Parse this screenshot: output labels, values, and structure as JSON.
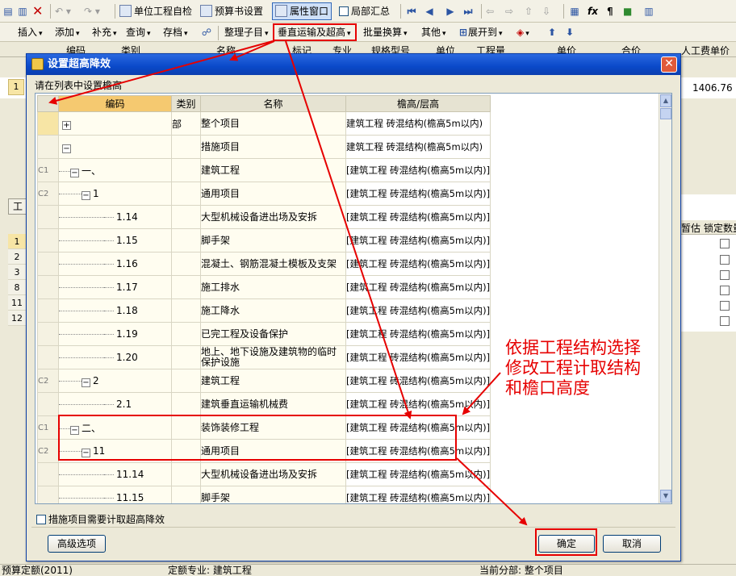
{
  "toolbar1": {
    "unit_check": "单位工程自检",
    "budget_settings": "预算书设置",
    "attr_window": "属性窗口",
    "partial_summary": "局部汇总"
  },
  "toolbar2": {
    "insert": "插入",
    "add": "添加",
    "supplement": "补充",
    "query": "查询",
    "archive": "存档",
    "organize": "整理子目",
    "vertical_transport": "垂直运输及超高",
    "batch_convert": "批量换算",
    "other": "其他",
    "expand_to": "展开到"
  },
  "background": {
    "grid_header_labels": [
      "编码",
      "类别",
      "名称",
      "标记",
      "专业",
      "规格型号",
      "单位",
      "工程量",
      "单价",
      "合价",
      "人工费单价"
    ],
    "row1_number": "1",
    "row1_value": "1406.76",
    "bottom_panel_tab": "工",
    "right_headers": [
      "暂估",
      "锁定数量"
    ],
    "row_numbers": [
      "1",
      "2",
      "3",
      "8",
      "11",
      "12"
    ]
  },
  "dialog": {
    "title": "设置超高降效",
    "hint": "请在列表中设置檐高",
    "columns": {
      "code": "编码",
      "type": "类别",
      "name": "名称",
      "height": "檐高/层高"
    },
    "rows": [
      {
        "rh": "",
        "code": "",
        "type": "部",
        "name": "整个项目",
        "value": "建筑工程 砖混结构(檐高5m以内)"
      },
      {
        "rh": "",
        "code": "",
        "type": "",
        "name": "措施项目",
        "value": "建筑工程 砖混结构(檐高5m以内)"
      },
      {
        "rh": "C1",
        "code": "一、",
        "type": "",
        "name": "建筑工程",
        "value": "[建筑工程 砖混结构(檐高5m以内)]"
      },
      {
        "rh": "C2",
        "code": "1",
        "type": "",
        "name": "通用项目",
        "value": "[建筑工程 砖混结构(檐高5m以内)]"
      },
      {
        "rh": "",
        "code": "1.14",
        "type": "",
        "name": "大型机械设备进出场及安拆",
        "value": "[建筑工程 砖混结构(檐高5m以内)]"
      },
      {
        "rh": "",
        "code": "1.15",
        "type": "",
        "name": "脚手架",
        "value": "[建筑工程 砖混结构(檐高5m以内)]"
      },
      {
        "rh": "",
        "code": "1.16",
        "type": "",
        "name": "混凝土、钢筋混凝土模板及支架",
        "value": "[建筑工程 砖混结构(檐高5m以内)]"
      },
      {
        "rh": "",
        "code": "1.17",
        "type": "",
        "name": "施工排水",
        "value": "[建筑工程 砖混结构(檐高5m以内)]"
      },
      {
        "rh": "",
        "code": "1.18",
        "type": "",
        "name": "施工降水",
        "value": "[建筑工程 砖混结构(檐高5m以内)]"
      },
      {
        "rh": "",
        "code": "1.19",
        "type": "",
        "name": "已完工程及设备保护",
        "value": "[建筑工程 砖混结构(檐高5m以内)]"
      },
      {
        "rh": "",
        "code": "1.20",
        "type": "",
        "name": "地上、地下设施及建筑物的临时保护设施",
        "value": "[建筑工程 砖混结构(檐高5m以内)]"
      },
      {
        "rh": "C2",
        "code": "2",
        "type": "",
        "name": "建筑工程",
        "value": "[建筑工程 砖混结构(檐高5m以内)]"
      },
      {
        "rh": "",
        "code": "2.1",
        "type": "",
        "name": "建筑垂直运输机械费",
        "value": "[建筑工程 砖混结构(檐高5m以内)]"
      },
      {
        "rh": "C1",
        "code": "二、",
        "type": "",
        "name": "装饰装修工程",
        "value": "[建筑工程 砖混结构(檐高5m以内)]"
      },
      {
        "rh": "C2",
        "code": "11",
        "type": "",
        "name": "通用项目",
        "value": "[建筑工程 砖混结构(檐高5m以内)]"
      },
      {
        "rh": "",
        "code": "11.14",
        "type": "",
        "name": "大型机械设备进出场及安拆",
        "value": "[建筑工程 砖混结构(檐高5m以内)]"
      },
      {
        "rh": "",
        "code": "11.15",
        "type": "",
        "name": "脚手架",
        "value": "[建筑工程 砖混结构(檐高5m以内)]"
      }
    ],
    "checkbox_label": "措施项目需要计取超高降效",
    "advanced_button": "高级选项",
    "ok_button": "确定",
    "cancel_button": "取消"
  },
  "annotation": {
    "line1": "依据工程结构选择",
    "line2": "修改工程计取结构",
    "line3": "和檐口高度"
  },
  "statusbar": {
    "left": "预算定额(2011)",
    "middle": "定额专业: 建筑工程",
    "right": "当前分部: 整个项目"
  }
}
